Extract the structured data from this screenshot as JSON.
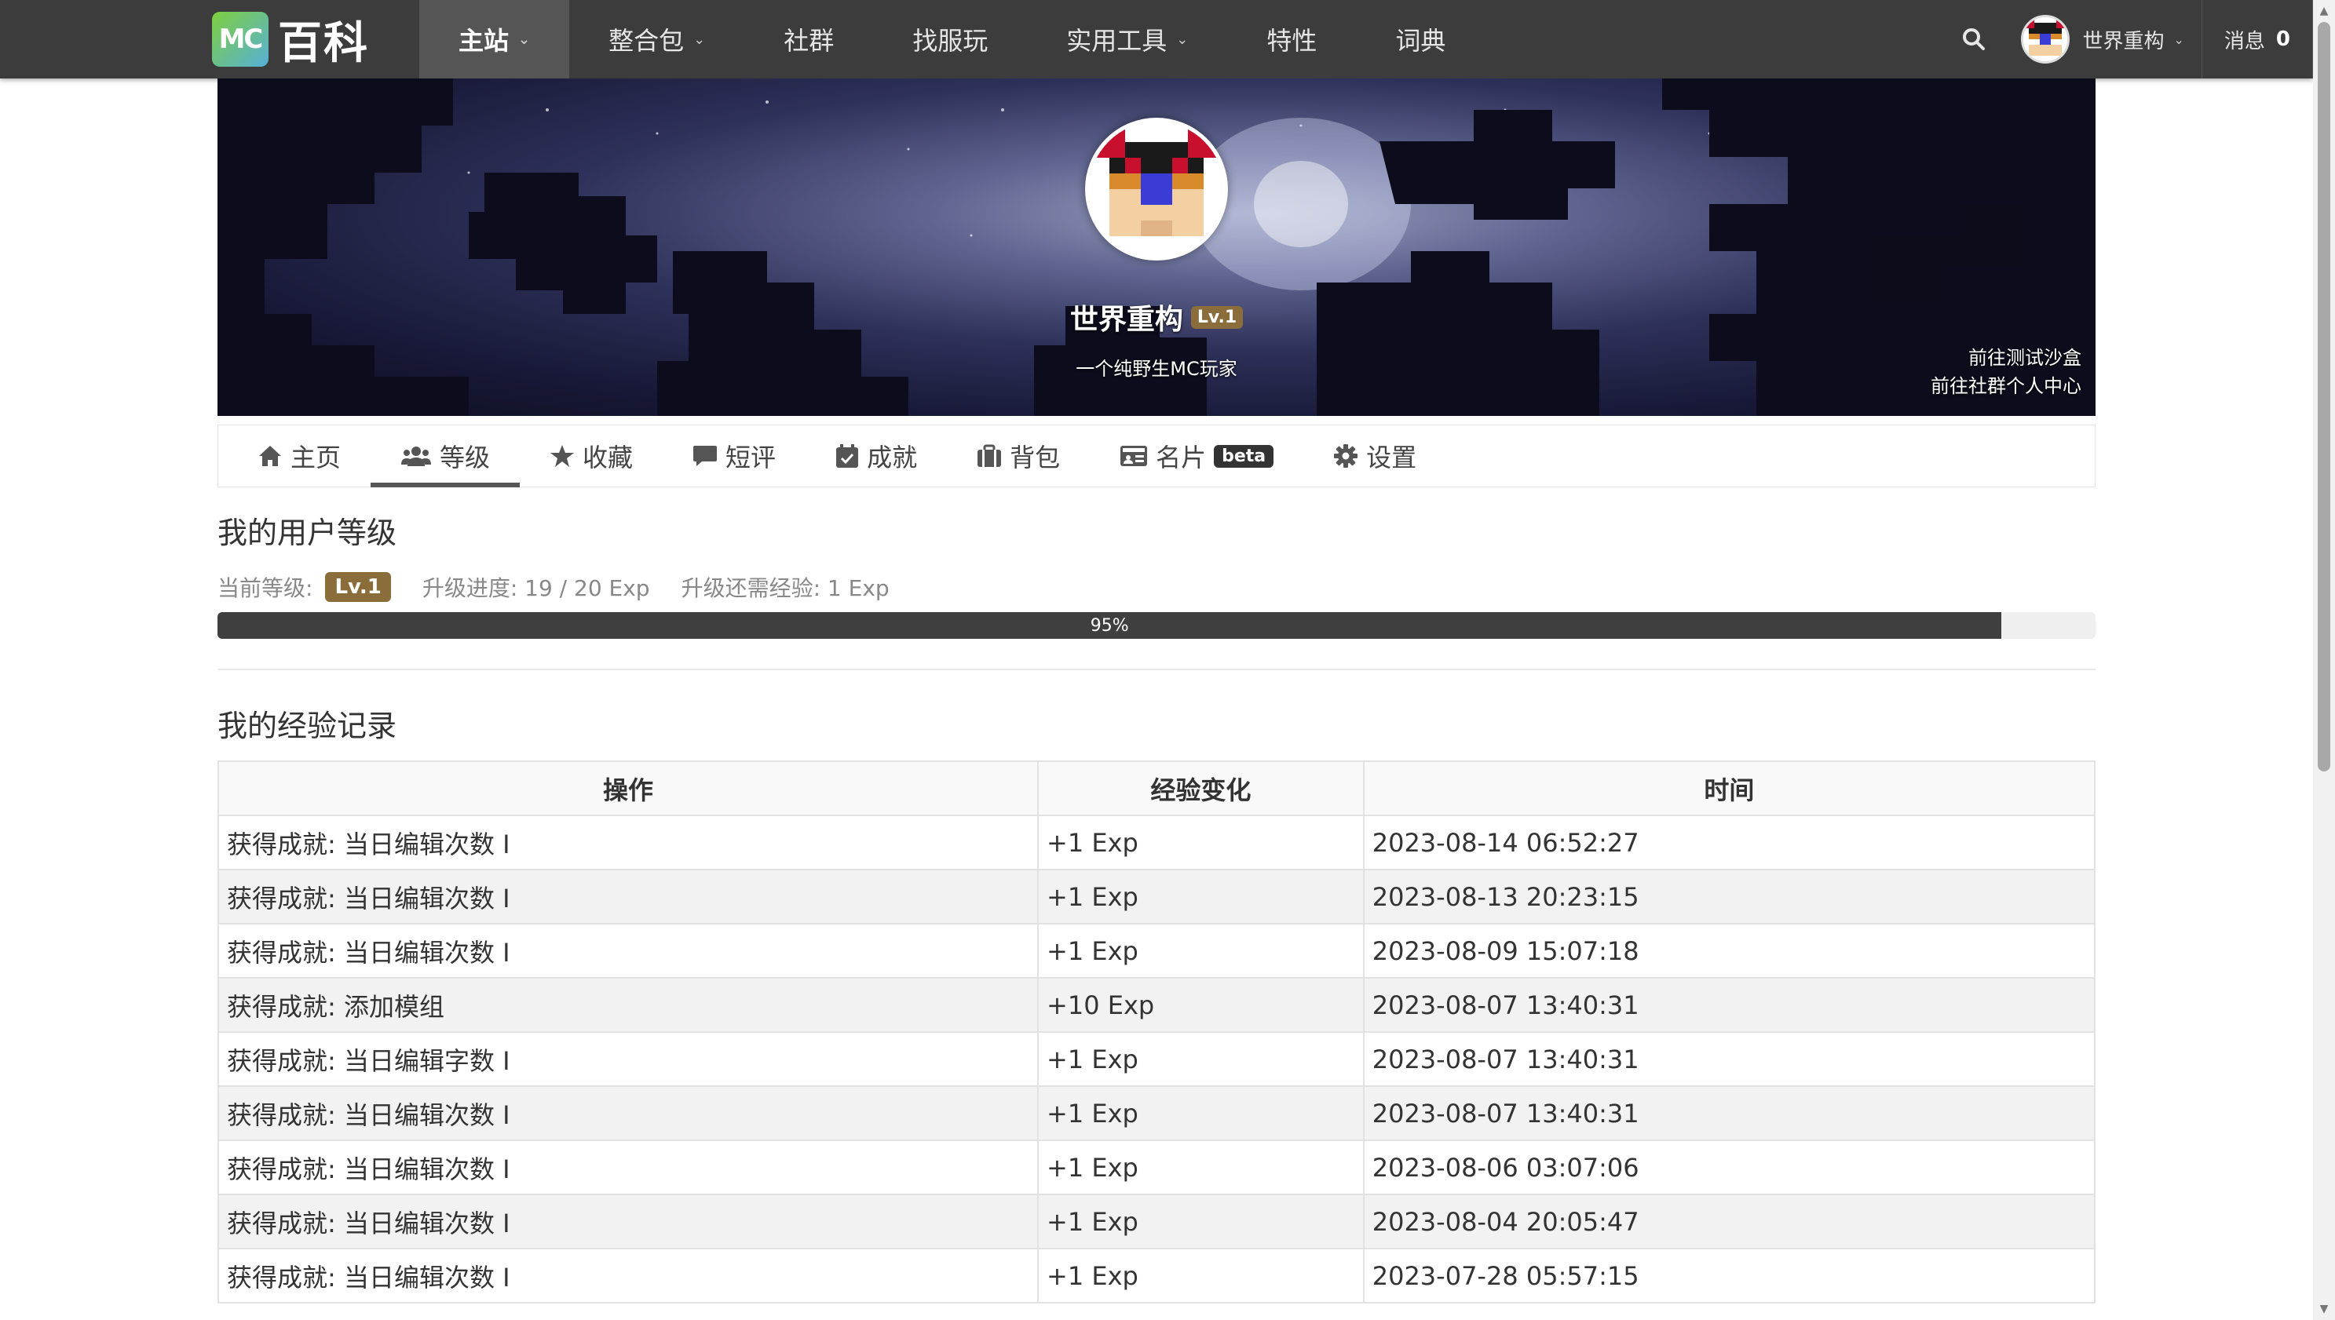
{
  "nav": {
    "logo_mc": "MC",
    "logo_text": "百科",
    "items": [
      {
        "label": "主站",
        "dropdown": true,
        "active": true
      },
      {
        "label": "整合包",
        "dropdown": true,
        "active": false
      },
      {
        "label": "社群",
        "dropdown": false,
        "active": false
      },
      {
        "label": "找服玩",
        "dropdown": false,
        "active": false
      },
      {
        "label": "实用工具",
        "dropdown": true,
        "active": false
      },
      {
        "label": "特性",
        "dropdown": false,
        "active": false
      },
      {
        "label": "词典",
        "dropdown": false,
        "active": false
      }
    ],
    "user_name": "世界重构",
    "messages_label": "消息",
    "messages_count": "0"
  },
  "profile": {
    "name": "世界重构",
    "level_badge": "Lv.1",
    "bio": "一个纯野生MC玩家",
    "link_sandbox": "前往测试沙盒",
    "link_community": "前往社群个人中心"
  },
  "tabs": [
    {
      "label": "主页",
      "icon": "home-icon",
      "active": false
    },
    {
      "label": "等级",
      "icon": "users-icon",
      "active": true
    },
    {
      "label": "收藏",
      "icon": "star-icon",
      "active": false
    },
    {
      "label": "短评",
      "icon": "comment-icon",
      "active": false
    },
    {
      "label": "成就",
      "icon": "calendar-check-icon",
      "active": false
    },
    {
      "label": "背包",
      "icon": "briefcase-icon",
      "active": false
    },
    {
      "label": "名片",
      "icon": "id-card-icon",
      "active": false,
      "badge": "beta"
    },
    {
      "label": "设置",
      "icon": "gear-icon",
      "active": false
    }
  ],
  "level": {
    "title": "我的用户等级",
    "current_label": "当前等级:",
    "current_value": "Lv.1",
    "progress_text": "升级进度: 19 / 20 Exp",
    "remaining_text": "升级还需经验: 1 Exp",
    "progress_percent": 95,
    "progress_label": "95%"
  },
  "records": {
    "title": "我的经验记录",
    "headers": [
      "操作",
      "经验变化",
      "时间"
    ],
    "rows": [
      [
        "获得成就: 当日编辑次数 I",
        "+1 Exp",
        "2023-08-14 06:52:27"
      ],
      [
        "获得成就: 当日编辑次数 I",
        "+1 Exp",
        "2023-08-13 20:23:15"
      ],
      [
        "获得成就: 当日编辑次数 I",
        "+1 Exp",
        "2023-08-09 15:07:18"
      ],
      [
        "获得成就: 添加模组",
        "+10 Exp",
        "2023-08-07 13:40:31"
      ],
      [
        "获得成就: 当日编辑字数 I",
        "+1 Exp",
        "2023-08-07 13:40:31"
      ],
      [
        "获得成就: 当日编辑次数 I",
        "+1 Exp",
        "2023-08-07 13:40:31"
      ],
      [
        "获得成就: 当日编辑次数 I",
        "+1 Exp",
        "2023-08-06 03:07:06"
      ],
      [
        "获得成就: 当日编辑次数 I",
        "+1 Exp",
        "2023-08-04 20:05:47"
      ],
      [
        "获得成就: 当日编辑次数 I",
        "+1 Exp",
        "2023-07-28 05:57:15"
      ]
    ]
  },
  "colors": {
    "nav_bg": "#3c3c3c",
    "nav_active": "#555555",
    "level_badge": "#8a6d3b",
    "progress_fill": "#3f3f3f"
  }
}
